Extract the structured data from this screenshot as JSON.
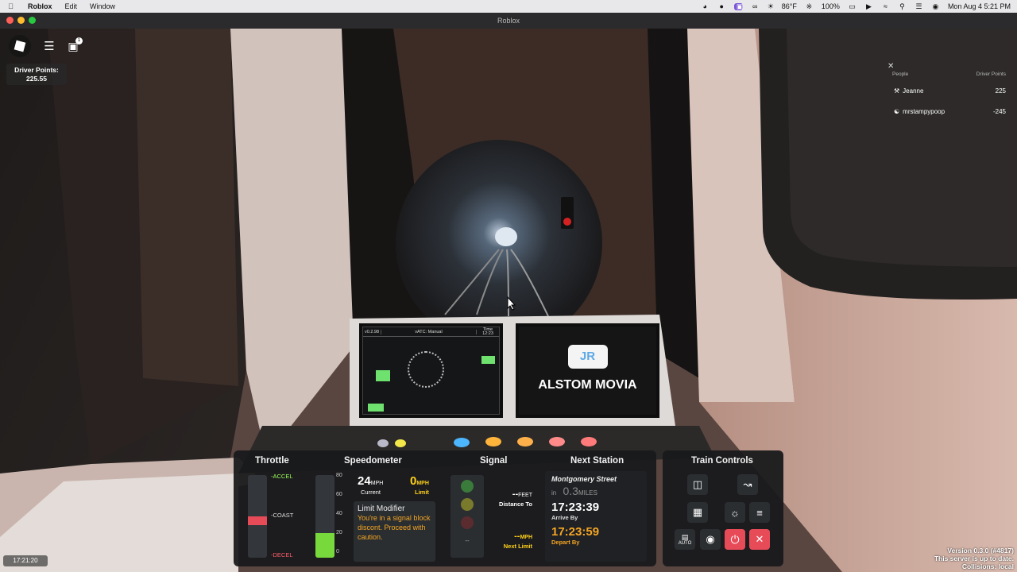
{
  "menubar": {
    "app": "Roblox",
    "items": [
      "Edit",
      "Window"
    ],
    "weather": "86°F",
    "battery": "100%",
    "datetime": "Mon Aug 4  5:21 PM"
  },
  "window": {
    "title": "Roblox"
  },
  "overlay": {
    "points_label": "Driver Points:",
    "points_value": "225.55",
    "chat_badge": "1",
    "clock": "17:21:20"
  },
  "players": {
    "col_people": "People",
    "col_points": "Driver Points",
    "rows": [
      {
        "name": "Jeanne",
        "points": "225"
      },
      {
        "name": "mrstampypoop",
        "points": "-245"
      }
    ]
  },
  "cab": {
    "screen_left": {
      "version": "v0.2.98",
      "mode": "vATC: Manual",
      "time_label": "Time",
      "time": "12:23"
    },
    "screen_right": {
      "logo": "JR",
      "text": "ALSTOM MOVIA"
    }
  },
  "hud": {
    "throttle": {
      "title": "Throttle",
      "accel": "-ACCEL",
      "coast": "-COAST",
      "decel": "-DECEL",
      "level_fraction": -0.28
    },
    "speedometer": {
      "title": "Speedometer",
      "ticks": [
        "80",
        "60",
        "40",
        "20",
        "0"
      ],
      "current_value": "24",
      "current_unit": "MPH",
      "current_label": "Current",
      "limit_value": "0",
      "limit_unit": "MPH",
      "limit_label": "Limit",
      "modifier_title": "Limit Modifier",
      "modifier_text": "You're in a signal block discont. Proceed with caution.",
      "bar_fraction": 0.3
    },
    "signal": {
      "title": "Signal",
      "feet_value": "--",
      "feet_unit": "FEET",
      "distance_label": "Distance To",
      "mph_value": "--",
      "mph_unit": "MPH",
      "next_limit_label": "Next Limit",
      "aspect_label": "--"
    },
    "next_station": {
      "title": "Next Station",
      "station": "Montgomery Street",
      "in_label": "in",
      "distance": "0.3",
      "distance_unit": "MILES",
      "arrive_time": "17:23:39",
      "arrive_label": "Arrive By",
      "depart_time": "17:23:59",
      "depart_label": "Depart By"
    },
    "train_controls": {
      "title": "Train Controls",
      "auto_label": "AUTO"
    }
  },
  "server": {
    "version": "Version 0.3.0 (#4817)",
    "status": "This server is up to date.",
    "collisions": "Collisions: local"
  }
}
